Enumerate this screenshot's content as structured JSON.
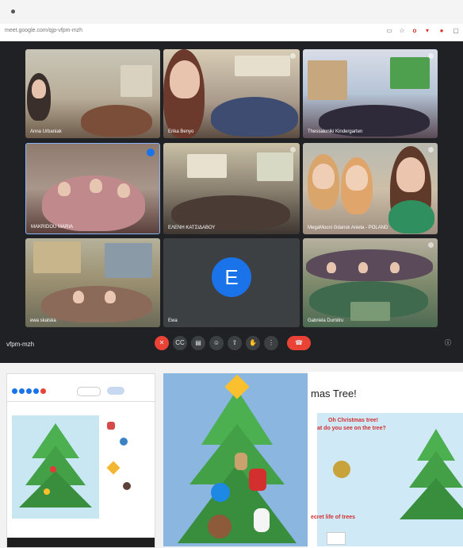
{
  "browser": {
    "url": "meet.google.com/qjp-vfpm-mzh",
    "toolbar_icons": [
      "cast-icon",
      "star-icon",
      "extension-icon",
      "shield-icon",
      "profile-icon",
      "menu-icon"
    ]
  },
  "meet": {
    "meeting_code": "vfpm-mzh",
    "participants": [
      {
        "name": "Anna Urbaniak"
      },
      {
        "name": "Erika Benyo"
      },
      {
        "name": "Thessaloniki Kindergarten"
      },
      {
        "name": "MAKRIDOU MARIA"
      },
      {
        "name": "ΕΛΕΝΗ ΚΑΤΣΙΔΑΒΟΥ"
      },
      {
        "name": "MegaMocni Gdansk Aniela - POLAND"
      },
      {
        "name": "ewa skalska"
      },
      {
        "name": "Ewa",
        "initial": "E"
      },
      {
        "name": "Gabriela Dumitru"
      }
    ],
    "controls": [
      "mic-off-icon",
      "captions-icon",
      "present-icon",
      "emoji-icon",
      "screen-share-icon",
      "raise-hand-icon",
      "more-icon",
      "end-call-icon"
    ]
  },
  "slides": {
    "title_partial": "mas Tree!",
    "song_line1": "Oh Christmas tree!",
    "song_line2": "at do you see on the tree?",
    "bottom_text": "ecret life of trees"
  },
  "colors": {
    "meet_bg": "#202124",
    "end_call": "#ea4335",
    "avatar_blue": "#1a73e8",
    "tree_green": "#3fa54a"
  }
}
